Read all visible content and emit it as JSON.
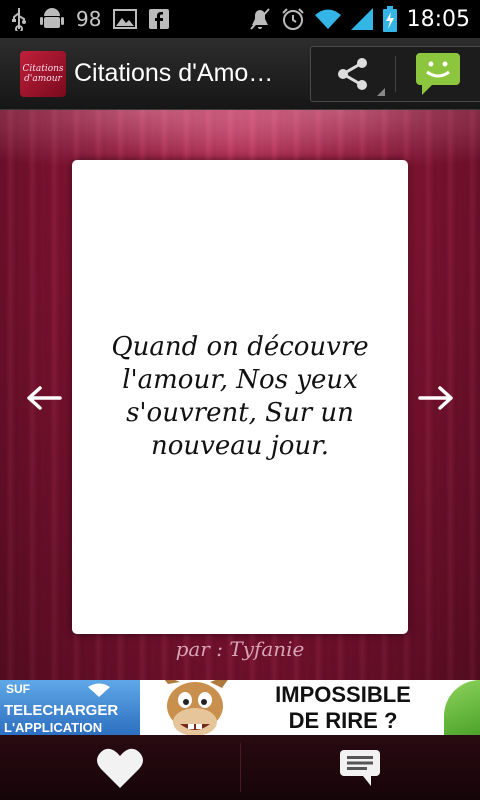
{
  "status_bar": {
    "notification_count": "98",
    "time": "18:05",
    "icons": [
      "usb-icon",
      "android-debug-icon",
      "image-icon",
      "facebook-icon",
      "mute-icon",
      "alarm-icon",
      "wifi-icon",
      "signal-icon",
      "battery-charging-icon"
    ]
  },
  "action_bar": {
    "app_icon_text": "Citations d'amour",
    "title": "Citations d'Amo…",
    "actions": [
      "share-icon",
      "sms-icon"
    ]
  },
  "card": {
    "quote": "Quand on découvre l'amour, Nos yeux s'ouvrent, Sur un nouveau jour."
  },
  "author": "par : Tyfanie",
  "ad": {
    "signal_text": "SUF",
    "cta_line1": "TELECHARGER",
    "cta_line2": "L'APPLICATION",
    "headline_line1": "IMPOSSIBLE",
    "headline_line2": "DE RIRE ?"
  },
  "bottom_bar": {
    "buttons": [
      "heart-icon",
      "comment-icon"
    ]
  },
  "colors": {
    "background_red": "#8e1538",
    "card": "#ffffff",
    "author_text": "#d7a3b5",
    "sms_green": "#8cc63f"
  }
}
